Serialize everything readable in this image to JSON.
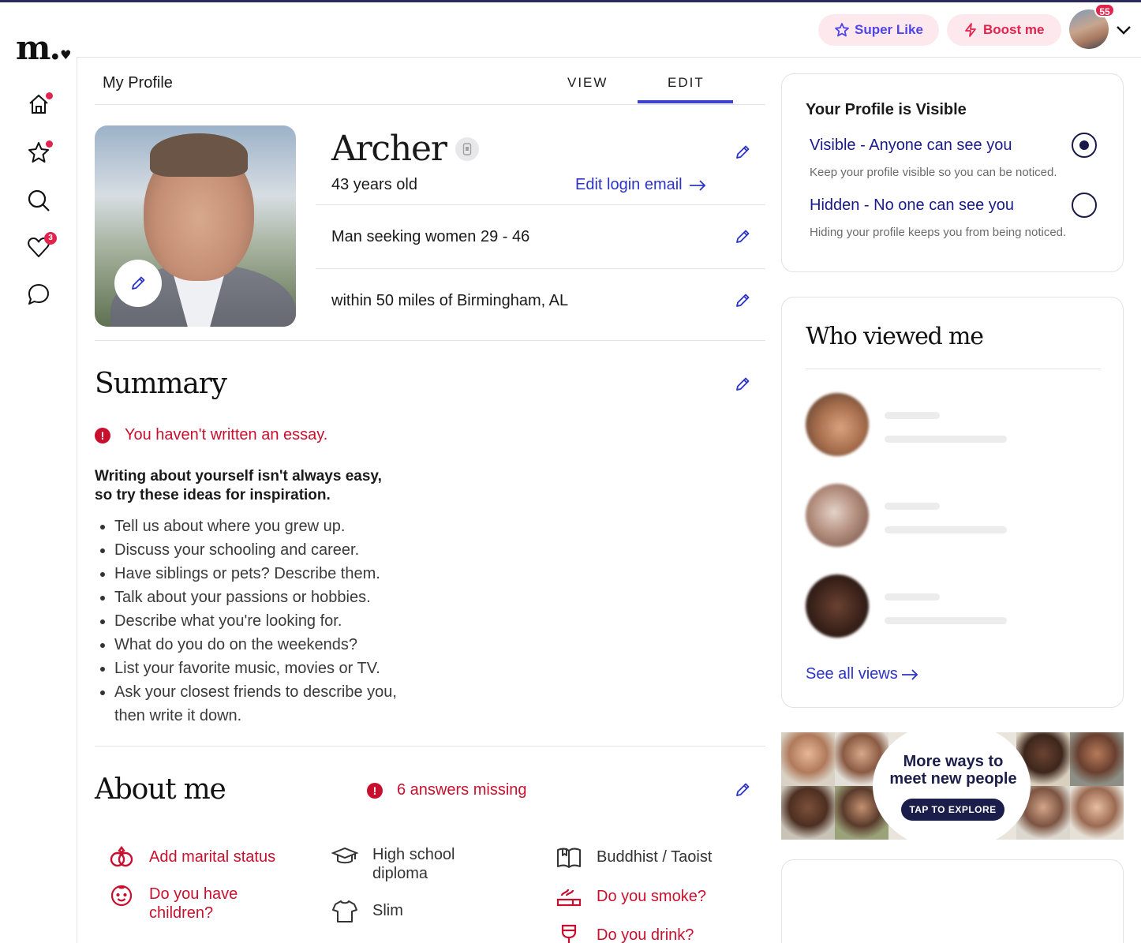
{
  "brand": {
    "logo": "m.",
    "logo_heart": "♥"
  },
  "rail": {
    "likes_count": "3"
  },
  "header": {
    "super_like": "Super Like",
    "boost": "Boost me",
    "avatar_badge": "55"
  },
  "profile": {
    "page_title": "My Profile",
    "tabs": [
      {
        "label": "VIEW"
      },
      {
        "label": "EDIT"
      }
    ],
    "name": "Archer",
    "age": "43 years old",
    "edit_login_email": "Edit login email",
    "seeking": "Man seeking women 29 - 46",
    "location": "within 50 miles of Birmingham, AL"
  },
  "summary": {
    "heading": "Summary",
    "alert": "You haven't written an essay.",
    "ideas_heading_1": "Writing about yourself isn't always easy,",
    "ideas_heading_2": "so try these ideas for inspiration.",
    "ideas": [
      "Tell us about where you grew up.",
      "Discuss your schooling and career.",
      "Have siblings or pets? Describe them.",
      "Talk about your passions or hobbies.",
      "Describe what you're looking for.",
      "What do you do on the weekends?",
      "List your favorite music, movies or TV.",
      "Ask your closest friends to describe you, then write it down."
    ]
  },
  "about": {
    "heading": "About me",
    "alert": "6 answers missing",
    "items": [
      {
        "label": "Add marital status",
        "icon": "rings-icon"
      },
      {
        "label": "Do you have children?",
        "icon": "baby-icon"
      },
      {
        "label": "High school diploma",
        "icon": "graduation-cap-icon"
      },
      {
        "label": "Slim",
        "icon": "shirt-icon"
      },
      {
        "label": "Buddhist / Taoist",
        "icon": "book-icon"
      },
      {
        "label": "Do you smoke?",
        "icon": "smoke-icon"
      },
      {
        "label": "Do you drink?",
        "icon": "wine-glass-icon"
      }
    ]
  },
  "visibility": {
    "title": "Your Profile is Visible",
    "visible_label": "Visible - Anyone can see you",
    "visible_sub": "Keep your profile visible so you can be noticed.",
    "hidden_label": "Hidden - No one can see you",
    "hidden_sub": "Hiding your profile keeps you from being noticed.",
    "selected": "visible"
  },
  "viewers": {
    "heading": "Who viewed me",
    "see_all": "See all views"
  },
  "banner": {
    "line1": "More ways to",
    "line2": "meet new people",
    "button": "TAP TO EXPLORE"
  },
  "colors": {
    "accent": "#2c34c7",
    "alert": "#c8102e",
    "badge": "#e0244d",
    "navy": "#1b1d4a"
  }
}
